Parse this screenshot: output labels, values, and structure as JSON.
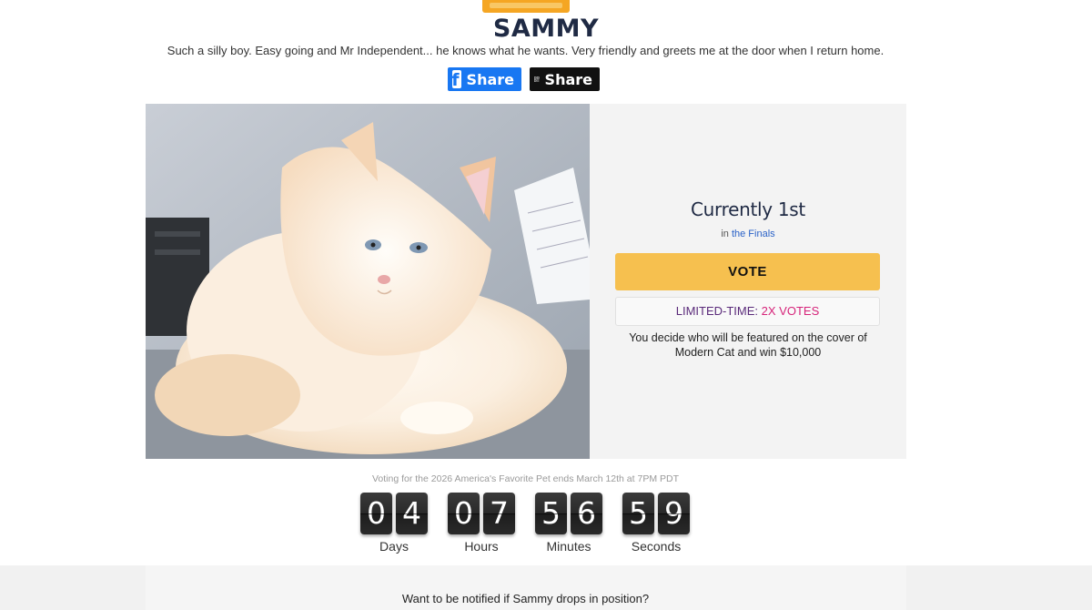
{
  "pet": {
    "name": "SAMMY",
    "description": "Such a silly boy. Easy going and Mr Independent... he knows what he wants. Very friendly and greets me at the door when I return home."
  },
  "share": [
    {
      "label": "Share",
      "icon": "facebook-icon"
    },
    {
      "label": "Share",
      "icon": "qr-code-icon"
    }
  ],
  "status": {
    "rank": "Currently 1st",
    "in_prefix": "in",
    "round": "the Finals"
  },
  "vote_button": "VOTE",
  "promo": {
    "label": "LIMITED-TIME:",
    "highlight": "2X VOTES"
  },
  "panel_note": "You decide who will be featured on the cover of Modern Cat and win $10,000",
  "voting_ends": "Voting for the 2026 America's Favorite Pet ends March 12th at 7PM PDT",
  "countdown": [
    {
      "digits": [
        "0",
        "4"
      ],
      "label": "Days"
    },
    {
      "digits": [
        "0",
        "7"
      ],
      "label": "Hours"
    },
    {
      "digits": [
        "5",
        "6"
      ],
      "label": "Minutes"
    },
    {
      "digits": [
        "5",
        "9"
      ],
      "label": "Seconds"
    }
  ],
  "notify_text": "Want to be notified if Sammy drops in position?",
  "colors": {
    "vote": "#f6c04f",
    "facebook": "#1877f2",
    "badge": "#f5a623",
    "link": "#2a62c7",
    "promo_highlight": "#d6247a"
  }
}
